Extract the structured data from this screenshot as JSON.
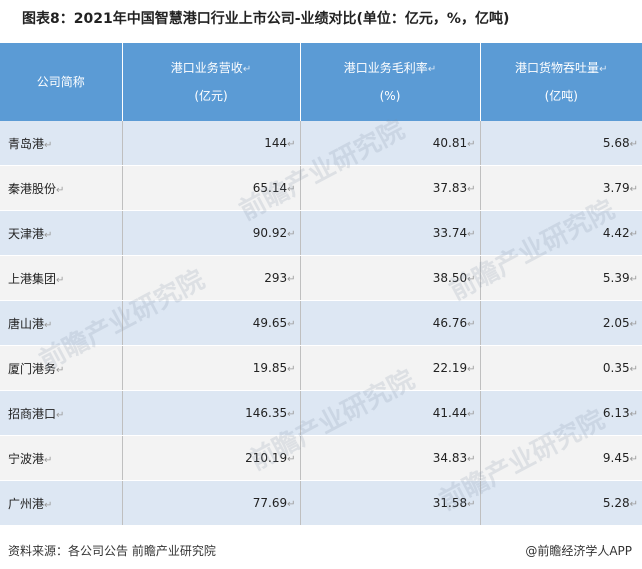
{
  "title": "图表8：2021年中国智慧港口行业上市公司-业绩对比(单位：亿元，%，亿吨)",
  "table": {
    "headers": [
      {
        "line1": "公司简称",
        "line2": ""
      },
      {
        "line1": "港口业务营收",
        "line2": "(亿元)"
      },
      {
        "line1": "港口业务毛利率",
        "line2": "(%)"
      },
      {
        "line1": "港口货物吞吐量",
        "line2": "(亿吨)"
      }
    ],
    "rows": [
      {
        "name": "青岛港",
        "revenue": "144",
        "margin": "40.81",
        "throughput": "5.68"
      },
      {
        "name": "秦港股份",
        "revenue": "65.14",
        "margin": "37.83",
        "throughput": "3.79"
      },
      {
        "name": "天津港",
        "revenue": "90.92",
        "margin": "33.74",
        "throughput": "4.42"
      },
      {
        "name": "上港集团",
        "revenue": "293",
        "margin": "38.50",
        "throughput": "5.39"
      },
      {
        "name": "唐山港",
        "revenue": "49.65",
        "margin": "46.76",
        "throughput": "2.05"
      },
      {
        "name": "厦门港务",
        "revenue": "19.85",
        "margin": "22.19",
        "throughput": "0.35"
      },
      {
        "name": "招商港口",
        "revenue": "146.35",
        "margin": "41.44",
        "throughput": "6.13"
      },
      {
        "name": "宁波港",
        "revenue": "210.19",
        "margin": "34.83",
        "throughput": "9.45"
      },
      {
        "name": "广州港",
        "revenue": "77.69",
        "margin": "31.58",
        "throughput": "5.28"
      }
    ]
  },
  "watermark": "前瞻产业研究院",
  "footer": {
    "source": "资料来源：各公司公告 前瞻产业研究院",
    "brand": "@前瞻经济学人APP"
  }
}
